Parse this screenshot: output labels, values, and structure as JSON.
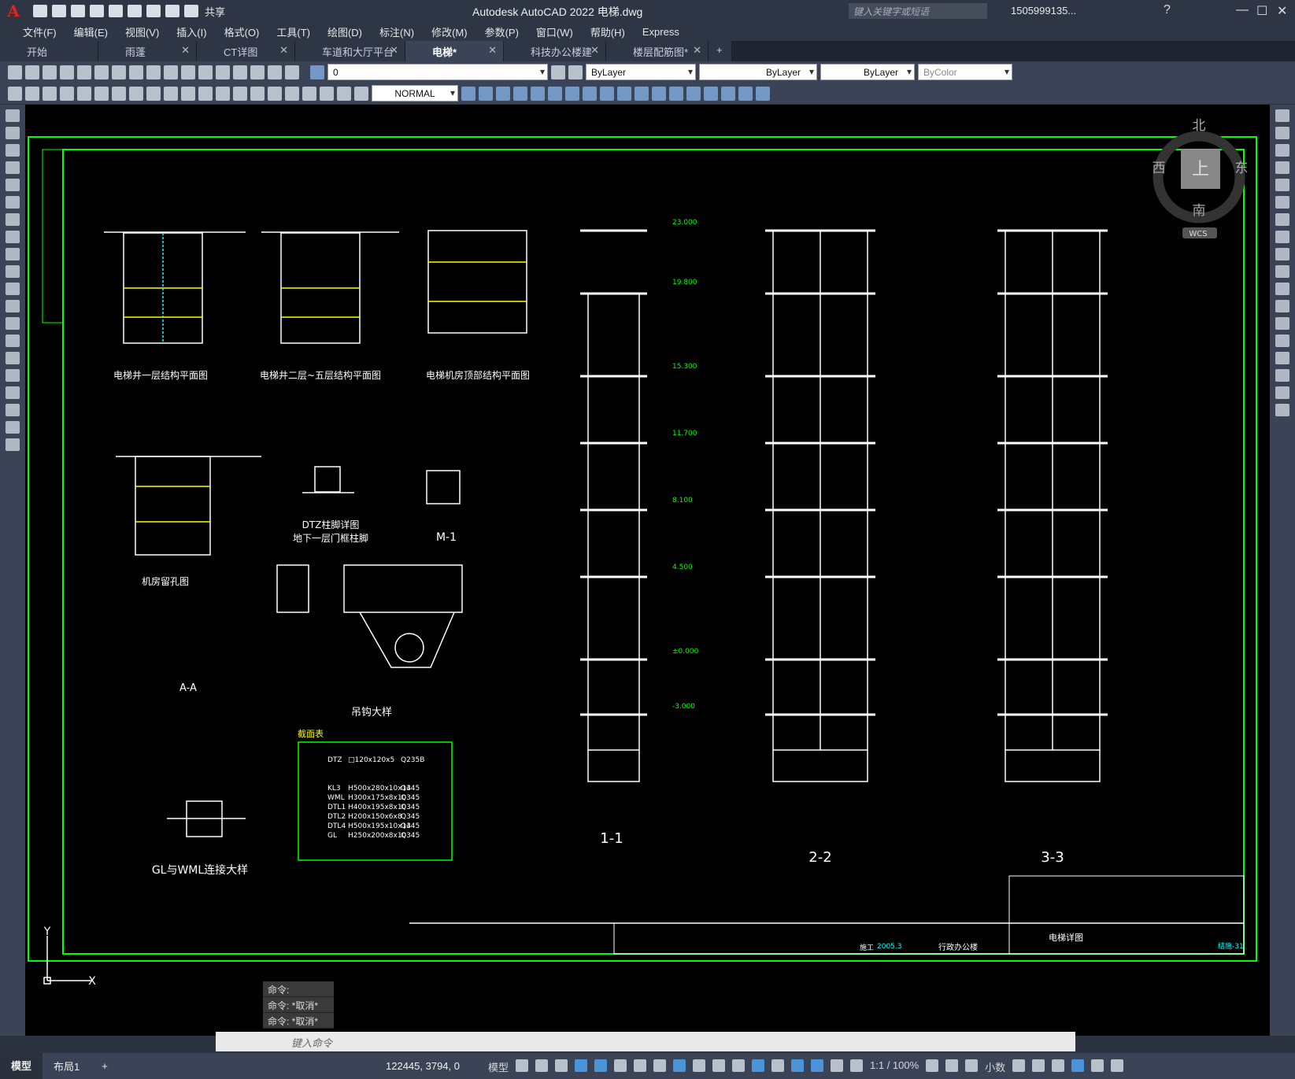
{
  "app": {
    "logo": "A",
    "title": "Autodesk AutoCAD 2022   电梯.dwg",
    "share": "共享",
    "search_placeholder": "键入关键字或短语",
    "user": "1505999135...",
    "help": "?"
  },
  "menu": [
    "文件(F)",
    "编辑(E)",
    "视图(V)",
    "插入(I)",
    "格式(O)",
    "工具(T)",
    "绘图(D)",
    "标注(N)",
    "修改(M)",
    "参数(P)",
    "窗口(W)",
    "帮助(H)",
    "Express"
  ],
  "file_tabs": [
    {
      "label": "开始",
      "active": false,
      "close": false
    },
    {
      "label": "雨蓬",
      "active": false,
      "close": true
    },
    {
      "label": "CT详图",
      "active": false,
      "close": true
    },
    {
      "label": "车道和大厅平台",
      "active": false,
      "close": true
    },
    {
      "label": "电梯*",
      "active": true,
      "close": true
    },
    {
      "label": "科技办公楼建筑*",
      "active": false,
      "close": true
    },
    {
      "label": "楼层配筋图*",
      "active": false,
      "close": true
    }
  ],
  "toolbar": {
    "layer": "0",
    "color": "ByLayer",
    "linetype": "ByLayer",
    "lineweight": "ByLayer",
    "plotstyle": "ByColor",
    "dimstyle": "NORMAL"
  },
  "viewcube": {
    "north": "北",
    "south": "南",
    "east": "东",
    "west": "西",
    "top": "上",
    "wcs": "WCS"
  },
  "command": {
    "history": [
      "命令:",
      "命令: *取消*",
      "命令: *取消*"
    ],
    "placeholder": "键入命令"
  },
  "status": {
    "tabs": [
      "模型",
      "布局1"
    ],
    "coords": "122445, 3794, 0",
    "model": "模型",
    "scale": "1:1 / 100%",
    "units": "小数"
  },
  "drawing": {
    "plans": [
      "电梯井一层结构平面图",
      "电梯井二层~五层结构平面图",
      "电梯机房顶部结构平面图",
      "机房留孔图",
      "DTZ柱脚详图",
      "地下一层门框柱脚",
      "M-1",
      "A-A",
      "吊钩大样",
      "GL与WML连接大样"
    ],
    "sections": [
      "1-1",
      "2-2",
      "3-3"
    ],
    "elevations": [
      "23.000",
      "19.800",
      "15.300",
      "11.700",
      "8.100",
      "4.500",
      "±0.000",
      "-3.000"
    ],
    "table_title": "截面表",
    "table_rows": [
      [
        "DTZ",
        "□120x120x5",
        "Q235B"
      ],
      [
        "KL3",
        "H500x280x10x14",
        "Q345"
      ],
      [
        "WML",
        "H300x175x8x10",
        "Q345"
      ],
      [
        "DTL1",
        "H400x195x8x10",
        "Q345"
      ],
      [
        "DTL2",
        "H200x150x6x8",
        "Q345"
      ],
      [
        "DTL4",
        "H500x195x10x14",
        "Q345"
      ],
      [
        "GL",
        "H250x200x8x10",
        "Q345"
      ]
    ],
    "titleblock": {
      "project": "行政办公楼",
      "drawing": "电梯详图",
      "date": "2005.3",
      "stage": "施工",
      "number": "结施-31"
    }
  }
}
